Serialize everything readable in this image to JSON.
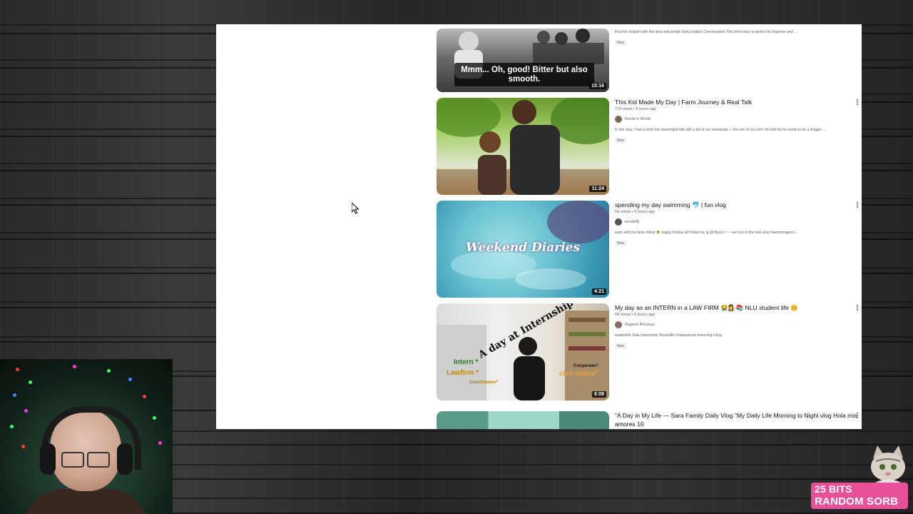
{
  "videos": [
    {
      "overlay_text": "Mmm... Oh, good! Bitter but also smooth.",
      "duration": "10:16",
      "desc": "Practice English with this slow and simple Daily English Conversation! This short story is perfect for beginner and ...",
      "new_badge": "New"
    },
    {
      "title": "This Kid Made My Day | Farm Journey & Real Talk",
      "stats": "714 views • 6 hours ago",
      "channel": "Dexter's World",
      "desc": "In this vlog, I had a short but meaningful talk with a kid at our restaurant — the son of our chef. He told me he wants to be a vlogger ...",
      "new_badge": "New",
      "duration": "11:24"
    },
    {
      "title": "spending my day swimming 🐬 | fun vlog",
      "stats": "No views • 6 hours ago",
      "channel": "keraloffy",
      "desc": "swim with my fams #diozi 🌻 happy holiday all! follow my ig @nflyzzz~~~ see you in the next vlog #swimmingpool ...",
      "new_badge": "New",
      "duration": "4:21",
      "thumb_text": "Weekend Diaries"
    },
    {
      "title": "My day as an INTERN in a LAW FIRM 😭👩‍⚖️📚 NLU student life 😊",
      "stats": "No views • 6 hours ago",
      "channel": "Ragnee Bhuarya",
      "desc": "studentlife #law #internship #hostellife #clataspirant #minivlog #vlog.",
      "new_badge": "New",
      "duration": "6:09",
      "thumb_text": "A day at Internship",
      "thumb_left1": "Intern *",
      "thumb_left2": "Lawfirm *",
      "thumb_left3": "Courtrooms*",
      "thumb_right1": "Corporate?",
      "thumb_right2": "civil cases*"
    },
    {
      "title": "\"A Day in My Life — Sara Family Daily Vlog \"My Daily Life Morning to Night vlog Hola mis amores 10"
    }
  ],
  "overlay": {
    "bits_line1": "25 BITS",
    "bits_line2": "RANDOM SORB",
    "bits_color": "#e8509a"
  }
}
